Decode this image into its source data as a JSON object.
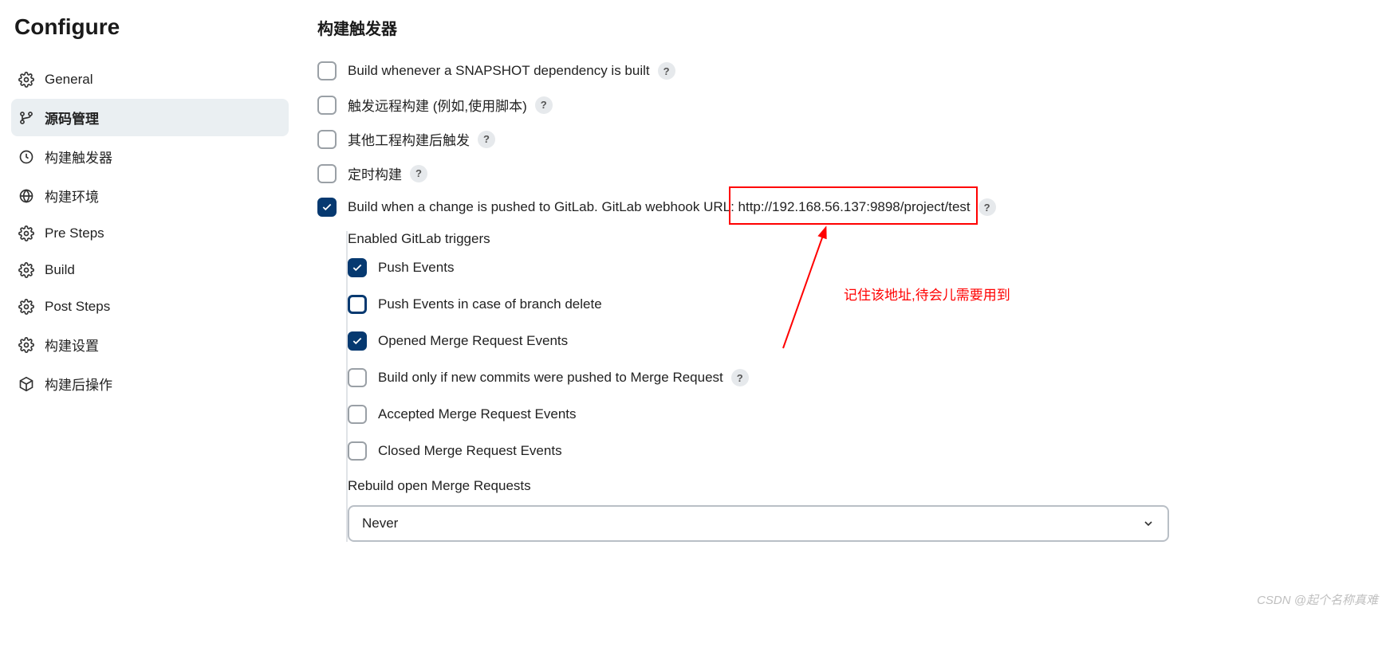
{
  "sidebar": {
    "title": "Configure",
    "items": [
      {
        "label": "General"
      },
      {
        "label": "源码管理"
      },
      {
        "label": "构建触发器"
      },
      {
        "label": "构建环境"
      },
      {
        "label": "Pre Steps"
      },
      {
        "label": "Build"
      },
      {
        "label": "Post Steps"
      },
      {
        "label": "构建设置"
      },
      {
        "label": "构建后操作"
      }
    ]
  },
  "main": {
    "section_title": "构建触发器",
    "triggers": [
      {
        "label": "Build whenever a SNAPSHOT dependency is built",
        "help": "?"
      },
      {
        "label": "触发远程构建 (例如,使用脚本)",
        "help": "?"
      },
      {
        "label": "其他工程构建后触发",
        "help": "?"
      },
      {
        "label": "定时构建",
        "help": "?"
      },
      {
        "label": "Build when a change is pushed to GitLab. GitLab webhook URL: http://192.168.56.137:9898/project/test",
        "help": "?"
      }
    ],
    "gitlab": {
      "enabled_label": "Enabled GitLab triggers",
      "sub": [
        {
          "label": "Push Events"
        },
        {
          "label": "Push Events in case of branch delete"
        },
        {
          "label": "Opened Merge Request Events"
        },
        {
          "label": "Build only if new commits were pushed to Merge Request",
          "help": "?"
        },
        {
          "label": "Accepted Merge Request Events"
        },
        {
          "label": "Closed Merge Request Events"
        }
      ],
      "rebuild_label": "Rebuild open Merge Requests",
      "rebuild_value": "Never"
    }
  },
  "annotation": {
    "text": "记住该地址,待会儿需要用到"
  },
  "watermark": "CSDN @起个名称真难"
}
